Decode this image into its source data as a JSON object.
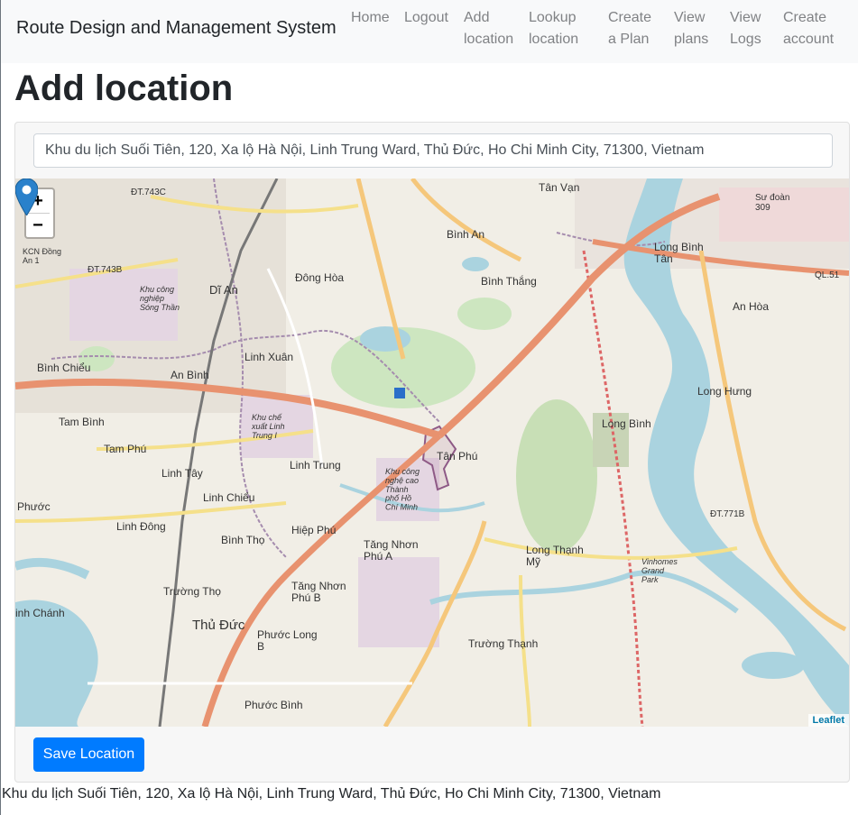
{
  "navbar": {
    "brand": "Route Design and Management System",
    "items": [
      {
        "label": "Home"
      },
      {
        "label": "Logout"
      },
      {
        "label": "Add\nlocation"
      },
      {
        "label": "Lookup\nlocation"
      },
      {
        "label": "Create\na Plan"
      },
      {
        "label": "View\nplans"
      },
      {
        "label": "View\nLogs"
      },
      {
        "label": "Create\naccount"
      }
    ]
  },
  "page": {
    "title": "Add location"
  },
  "form": {
    "address_value": "Khu du lịch Suối Tiên, 120, Xa lộ Hà Nội, Linh Trung Ward, Thủ Đức, Ho Chi Minh City, 71300, Vietnam",
    "save_label": "Save Location"
  },
  "map": {
    "zoom_in": "+",
    "zoom_out": "−",
    "attribution": "Leaflet",
    "labels": {
      "tan_van": "Tân Vạn",
      "binh_an": "Bình An",
      "dong_hoa": "Đông Hòa",
      "di_an": "Dĩ An",
      "binh_thang": "Bình Thắng",
      "long_binh_tan": "Long Bình\nTân",
      "an_hoa": "An Hòa",
      "binh_chieu": "Bình Chiểu",
      "an_binh": "An Bình",
      "linh_xuan": "Linh Xuân",
      "long_hung": "Long Hưng",
      "tam_binh": "Tam Bình",
      "tam_phu": "Tam Phú",
      "long_binh": "Long Bình",
      "tan_phu": "Tân Phú",
      "linh_trung": "Linh Trung",
      "linh_tay": "Linh Tây",
      "linh_chieu": "Linh Chiểu",
      "phuoc": "Phước",
      "linh_dong": "Linh Đông",
      "hiep_phu": "Hiệp Phú",
      "binh_tho": "Bình Thọ",
      "tang_nhon_phu_a": "Tăng Nhơn\nPhú A",
      "long_thanh_my": "Long Thạnh\nMỹ",
      "truong_tho": "Trường Thọ",
      "tang_nhon_phu_b": "Tăng Nhơn\nPhú B",
      "thu_duc": "Thủ Đức",
      "phuoc_long_b": "Phước Long\nB",
      "truong_thanh": "Trường Thạnh",
      "binh_chanh": "inh Chánh",
      "phuoc_binh": "Phước Bình",
      "dt743c": "ĐT.743C",
      "dt743b": "ĐT.743B",
      "dt771b": "ĐT.771B",
      "ql51": "QL.51",
      "su_doan": "Sư đoàn\n309",
      "kcn_dong_an": "KCN Đồng\nAn 1",
      "kcn_song_than": "Khu công\nnghiệp\nSóng Thần",
      "khu_che_xuat": "Khu chế\nxuất Linh\nTrung I",
      "khu_cong_nghe_cao": "Khu công\nnghệ cao\nThành\nphố Hồ\nChí Minh",
      "vinhomes": "Vinhomes\nGrand\nPark"
    }
  },
  "result": {
    "text": "Khu du lịch Suối Tiên, 120, Xa lộ Hà Nội, Linh Trung Ward, Thủ Đức, Ho Chi Minh City, 71300, Vietnam"
  }
}
